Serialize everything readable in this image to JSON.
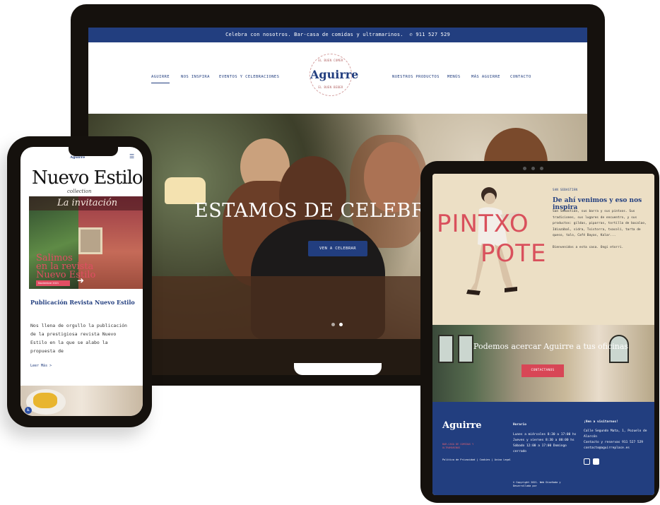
{
  "laptop": {
    "topbar": {
      "text": "Celebra con nosotros. Bar-casa de comidas y ultramarinos.",
      "phone": "911 527 529"
    },
    "nav_left": [
      "AGUIRRE",
      "NOS INSPIRA",
      "EVENTOS Y CELEBRACIONES"
    ],
    "nav_right": [
      "NUESTROS PRODUCTOS",
      "MENÚS",
      "MÁS AGUIRRE",
      "CONTACTO"
    ],
    "logo": {
      "wordmark": "Aguirre",
      "small_top": "EL BUEN COMER",
      "small_bottom": "EL BUEN BEBER"
    },
    "hero": {
      "title": "ESTAMOS DE CELEBRAC",
      "button": "VEN A CELEBRAR"
    }
  },
  "phone": {
    "logo": "Aguirre",
    "magazine_title": "Nuevo Estilo",
    "magazine_sub": "collection",
    "cover_title": "La invitación",
    "cover_overlay_1": "Salimos",
    "cover_overlay_2": "en la revista",
    "cover_overlay_3": "Nuevo Estilo",
    "cover_date": "Noviembre 2021",
    "post_title": "Publicación Revista Nuevo Estilo",
    "post_body": "Nos llena de orgullo la publicación de la prestigiosa revista Nuevo Estilo en la que se alabo la propuesta de",
    "read_more": "Leer Más >"
  },
  "tablet": {
    "pintxo": "PINTXO",
    "pote": "POTE",
    "kicker": "SAN SEBASTIÁN",
    "heading": "De ahí venimos y eso nos inspira",
    "body": "San Sebastián, sus barra y sus pintxos. Sus tradiciones, sus lugares de encuentro, y sus productos: gildas, piparras, tortilla de bacalao, Idiazábal, sidra, Txistorra, txacolí, tarta de queso, talo, Café Bayas, Kalar...",
    "welcome": "Bienvenidos a esta casa. Ongi etorri.",
    "banner_title": "Podemos acercar Aguirre a tus oficinas",
    "banner_button": "CONTACTANOS",
    "footer": {
      "logo": "Aguirre",
      "tagline": "BAR-CASA DE COMIDAS Y ULTRAMARINOS",
      "legal": "Política de Privacidad | Cookies | Aviso Legal",
      "hours_title": "Horario",
      "hours": "Lunes a miércoles 8:30 a 17:00 hs Jueves y viernes 8:30 a 00:00 hs Sábado 12:00 a 17:00 Domingo cerrado",
      "visit_title": "¡Ven a visitarnos!",
      "address": "Calle Segundo Mata, 1, Pozuelo de Alarcón",
      "contact": "Contacto y reservas 911 527 529 contacto@aguirreplace.es",
      "copyright": "© Copyright 2021. Web Diseñada y Desarrollada por"
    }
  },
  "colors": {
    "navy": "#223e7f",
    "coral": "#d9505c",
    "cream": "#ecdfc5",
    "device": "#15110d"
  }
}
